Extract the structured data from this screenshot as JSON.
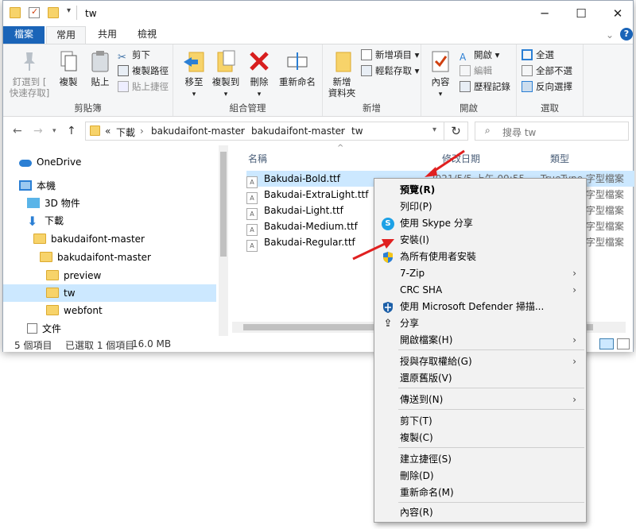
{
  "window": {
    "title": "tw",
    "min": "─",
    "max": "☐",
    "close": "✕"
  },
  "ribbon_tabs": [
    "檔案",
    "常用",
    "共用",
    "檢視"
  ],
  "clipboard": {
    "pin": "釘選到 [",
    "pin2": "快速存取]",
    "copy": "複製",
    "paste": "貼上",
    "cut": "剪下",
    "copy_path": "複製路徑",
    "paste_shortcut": "貼上捷徑",
    "label": "剪貼簿"
  },
  "organize": {
    "move": "移至",
    "copyto": "複製到",
    "delete": "刪除",
    "rename": "重新命名",
    "label": "組合管理"
  },
  "new": {
    "new_folder": "新增",
    "new_folder2": "資料夾",
    "new_item": "新增項目",
    "easy_access": "輕鬆存取",
    "label": "新增"
  },
  "open": {
    "properties": "內容",
    "open": "開啟",
    "edit": "編輯",
    "history": "歷程記錄",
    "label": "開啟"
  },
  "select": {
    "all": "全選",
    "none": "全部不選",
    "invert": "反向選擇",
    "label": "選取"
  },
  "address": {
    "chevron": "«",
    "parts": [
      "下載",
      "bakudaifont-master",
      "bakudaifont-master",
      "tw"
    ],
    "search_placeholder": "搜尋 tw"
  },
  "navpane": [
    {
      "label": "OneDrive",
      "icon": "cloud-icon"
    },
    {
      "label": "本機",
      "icon": "pc-icon"
    },
    {
      "label": "3D 物件",
      "icon": "3d-objects-icon"
    },
    {
      "label": "下載",
      "icon": "download-icon"
    },
    {
      "label": "bakudaifont-master",
      "icon": "folder-icon"
    },
    {
      "label": "bakudaifont-master",
      "icon": "folder-icon"
    },
    {
      "label": "preview",
      "icon": "folder-icon"
    },
    {
      "label": "tw",
      "icon": "folder-icon"
    },
    {
      "label": "webfont",
      "icon": "folder-icon"
    },
    {
      "label": "文件",
      "icon": "documents-icon"
    }
  ],
  "columns": {
    "name": "名稱",
    "date": "修改日期",
    "type": "類型"
  },
  "files": [
    {
      "name": "Bakudai-Bold.ttf",
      "date": "2021/5/5 上午 09:55",
      "type": "TrueType 字型檔案"
    },
    {
      "name": "Bakudai-ExtraLight.ttf",
      "date": "",
      "type": "TrueType 字型檔案"
    },
    {
      "name": "Bakudai-Light.ttf",
      "date": "",
      "type": "TrueType 字型檔案"
    },
    {
      "name": "Bakudai-Medium.ttf",
      "date": "",
      "type": "TrueType 字型檔案"
    },
    {
      "name": "Bakudai-Regular.ttf",
      "date": "",
      "type": "TrueType 字型檔案"
    }
  ],
  "status": {
    "count": "5 個項目",
    "selected": "已選取 1 個項目",
    "size": "16.0 MB"
  },
  "context_menu": {
    "preview": "預覽(R)",
    "print": "列印(P)",
    "skype": "使用 Skype 分享",
    "install": "安裝(I)",
    "install_all": "為所有使用者安裝",
    "zip": "7-Zip",
    "crc": "CRC SHA",
    "defender": "使用 Microsoft Defender 掃描...",
    "share": "分享",
    "open_with": "開啟檔案(H)",
    "give_access": "授與存取權給(G)",
    "restore": "還原舊版(V)",
    "send_to": "傳送到(N)",
    "cut": "剪下(T)",
    "copy": "複製(C)",
    "shortcut": "建立捷徑(S)",
    "delete": "刪除(D)",
    "rename": "重新命名(M)",
    "properties": "內容(R)"
  },
  "colors": {
    "accent": "#1a64b8",
    "selection": "#cce8ff",
    "arrow": "#e02020"
  }
}
